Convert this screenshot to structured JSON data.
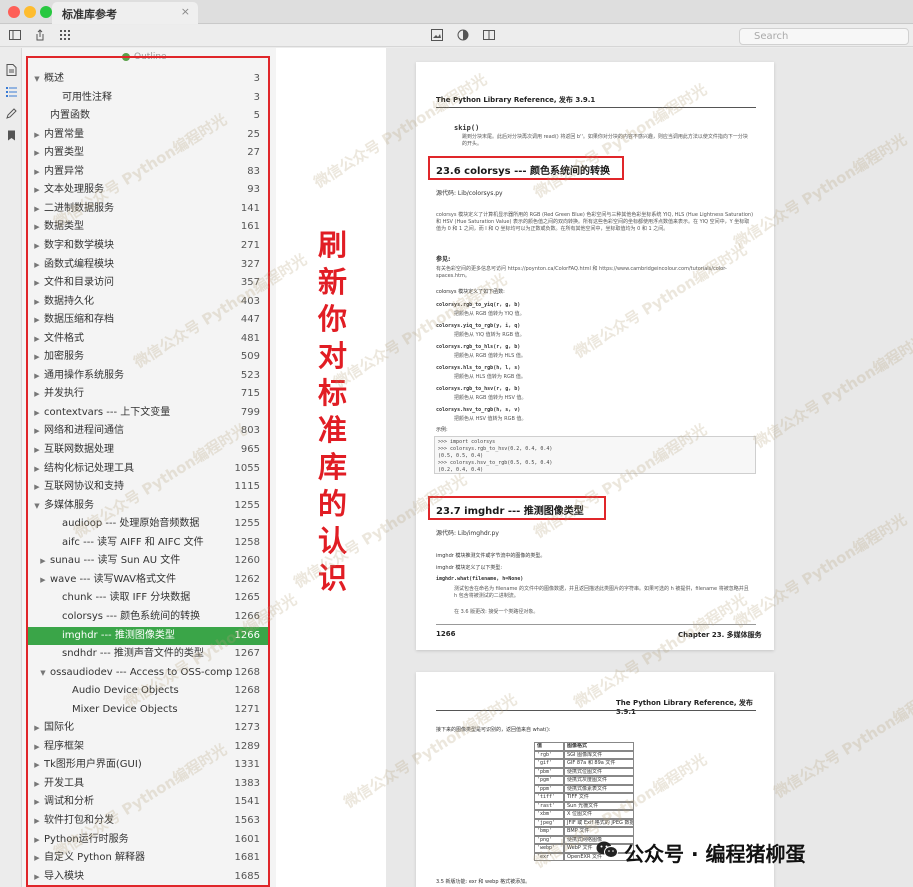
{
  "window": {
    "tab_title": "标准库参考",
    "tab_close": "×",
    "search_placeholder": "Search"
  },
  "sidebar": {
    "outline_label": "Outline",
    "items": [
      {
        "label": "概述",
        "page": "3",
        "level": 0,
        "arrow": "▼"
      },
      {
        "label": "可用性注释",
        "page": "3",
        "level": 2,
        "arrow": ""
      },
      {
        "label": "内置函数",
        "page": "5",
        "level": 1,
        "arrow": ""
      },
      {
        "label": "内置常量",
        "page": "25",
        "level": 0,
        "arrow": "▶"
      },
      {
        "label": "内置类型",
        "page": "27",
        "level": 0,
        "arrow": "▶"
      },
      {
        "label": "内置异常",
        "page": "83",
        "level": 0,
        "arrow": "▶"
      },
      {
        "label": "文本处理服务",
        "page": "93",
        "level": 0,
        "arrow": "▶"
      },
      {
        "label": "二进制数据服务",
        "page": "141",
        "level": 0,
        "arrow": "▶"
      },
      {
        "label": "数据类型",
        "page": "161",
        "level": 0,
        "arrow": "▶"
      },
      {
        "label": "数字和数学模块",
        "page": "271",
        "level": 0,
        "arrow": "▶"
      },
      {
        "label": "函数式编程模块",
        "page": "327",
        "level": 0,
        "arrow": "▶"
      },
      {
        "label": "文件和目录访问",
        "page": "357",
        "level": 0,
        "arrow": "▶"
      },
      {
        "label": "数据持久化",
        "page": "403",
        "level": 0,
        "arrow": "▶"
      },
      {
        "label": "数据压缩和存档",
        "page": "447",
        "level": 0,
        "arrow": "▶"
      },
      {
        "label": "文件格式",
        "page": "481",
        "level": 0,
        "arrow": "▶"
      },
      {
        "label": "加密服务",
        "page": "509",
        "level": 0,
        "arrow": "▶"
      },
      {
        "label": "通用操作系统服务",
        "page": "523",
        "level": 0,
        "arrow": "▶"
      },
      {
        "label": "并发执行",
        "page": "715",
        "level": 0,
        "arrow": "▶"
      },
      {
        "label": "contextvars --- 上下文变量",
        "page": "799",
        "level": 0,
        "arrow": "▶"
      },
      {
        "label": "网络和进程间通信",
        "page": "803",
        "level": 0,
        "arrow": "▶"
      },
      {
        "label": "互联网数据处理",
        "page": "965",
        "level": 0,
        "arrow": "▶"
      },
      {
        "label": "结构化标记处理工具",
        "page": "1055",
        "level": 0,
        "arrow": "▶"
      },
      {
        "label": "互联网协议和支持",
        "page": "1115",
        "level": 0,
        "arrow": "▶"
      },
      {
        "label": "多媒体服务",
        "page": "1255",
        "level": 0,
        "arrow": "▼"
      },
      {
        "label": "audioop --- 处理原始音频数据",
        "page": "1255",
        "level": 2,
        "arrow": ""
      },
      {
        "label": "aifc --- 读写 AIFF 和 AIFC 文件",
        "page": "1258",
        "level": 2,
        "arrow": ""
      },
      {
        "label": "sunau --- 读写 Sun AU 文件",
        "page": "1260",
        "level": 1,
        "arrow": "▶"
      },
      {
        "label": "wave --- 读写WAV格式文件",
        "page": "1262",
        "level": 1,
        "arrow": "▶"
      },
      {
        "label": "chunk --- 读取 IFF 分块数据",
        "page": "1265",
        "level": 2,
        "arrow": ""
      },
      {
        "label": "colorsys --- 颜色系统间的转换",
        "page": "1266",
        "level": 2,
        "arrow": ""
      },
      {
        "label": "imghdr --- 推测图像类型",
        "page": "1266",
        "level": 2,
        "arrow": "",
        "active": true
      },
      {
        "label": "sndhdr --- 推测声音文件的类型",
        "page": "1267",
        "level": 2,
        "arrow": ""
      },
      {
        "label": "ossaudiodev --- Access to OSS-compa...",
        "page": "1268",
        "level": 1,
        "arrow": "▼"
      },
      {
        "label": "Audio Device Objects",
        "page": "1268",
        "level": 3,
        "arrow": ""
      },
      {
        "label": "Mixer Device Objects",
        "page": "1271",
        "level": 3,
        "arrow": ""
      },
      {
        "label": "国际化",
        "page": "1273",
        "level": 0,
        "arrow": "▶"
      },
      {
        "label": "程序框架",
        "page": "1289",
        "level": 0,
        "arrow": "▶"
      },
      {
        "label": "Tk图形用户界面(GUI)",
        "page": "1331",
        "level": 0,
        "arrow": "▶"
      },
      {
        "label": "开发工具",
        "page": "1383",
        "level": 0,
        "arrow": "▶"
      },
      {
        "label": "调试和分析",
        "page": "1541",
        "level": 0,
        "arrow": "▶"
      },
      {
        "label": "软件打包和分发",
        "page": "1563",
        "level": 0,
        "arrow": "▶"
      },
      {
        "label": "Python运行时服务",
        "page": "1601",
        "level": 0,
        "arrow": "▶"
      },
      {
        "label": "自定义 Python 解释器",
        "page": "1681",
        "level": 0,
        "arrow": "▶"
      },
      {
        "label": "导入模块",
        "page": "1685",
        "level": 0,
        "arrow": "▶"
      }
    ]
  },
  "annotation": {
    "chars": [
      "刷",
      "新",
      "你",
      "对",
      "标",
      "准",
      "库",
      "的",
      "认",
      "识"
    ]
  },
  "page1": {
    "header": "The Python Library Reference, 发布 3.9.1",
    "skip_term": "skip()",
    "skip_desc": "跳到分块末尾。此后对分块再次调用 read() 将返回 b''。如果你对分块的内容不感兴趣，则应当调用此方法以使文件指向下一分块的开头。",
    "sec1_title": "23.6 colorsys --- 颜色系统间的转换",
    "sec1_source": "源代码: Lib/colorsys.py",
    "sec1_intro": "colorsys 模块定义了计算机显示器所用的 RGB (Red Green Blue) 色彩空间与三种其他色彩坐标系统 YIQ, HLS (Hue Lightness Saturation) 和 HSV (Hue Saturation Value) 表示的颜色值之间的双向转换。所有这些色彩空间的坐标都使用浮点数值来表示。在 YIQ 空间中，Y 坐标取值为 0 和 1 之间，而 I 和 Q 坐标均可以为正数或负数。在所有其他空间中，坐标取值均为 0 和 1 之间。",
    "see_also": "参见:",
    "see_also_text": "有关色彩空间的更多信息可访问 https://poynton.ca/ColorFAQ.html 和 https://www.cambridgeincolour.com/tutorials/color-spaces.htm。",
    "module_defines": "colorsys 模块定义了如下函数:",
    "functions": [
      {
        "sig": "colorsys.rgb_to_yiq(r, g, b)",
        "desc": "把颜色从 RGB 值转为 YIQ 值。"
      },
      {
        "sig": "colorsys.yiq_to_rgb(y, i, q)",
        "desc": "把颜色从 YIQ 值转为 RGB 值。"
      },
      {
        "sig": "colorsys.rgb_to_hls(r, g, b)",
        "desc": "把颜色从 RGB 值转为 HLS 值。"
      },
      {
        "sig": "colorsys.hls_to_rgb(h, l, s)",
        "desc": "把颜色从 HLS 值转为 RGB 值。"
      },
      {
        "sig": "colorsys.rgb_to_hsv(r, g, b)",
        "desc": "把颜色从 RGB 值转为 HSV 值。"
      },
      {
        "sig": "colorsys.hsv_to_rgb(h, s, v)",
        "desc": "把颜色从 HSV 值转为 RGB 值。"
      }
    ],
    "example_label": "示例:",
    "code_lines": [
      ">>> import colorsys",
      ">>> colorsys.rgb_to_hsv(0.2, 0.4, 0.4)",
      "(0.5, 0.5, 0.4)",
      ">>> colorsys.hsv_to_rgb(0.5, 0.5, 0.4)",
      "(0.2, 0.4, 0.4)"
    ],
    "sec2_title": "23.7 imghdr --- 推测图像类型",
    "sec2_source": "源代码: Lib/imghdr.py",
    "sec2_intro": "imghdr 模块推测文件或字节流中的图像的类型。",
    "sec2_defines": "imghdr 模块定义了以下类型:",
    "what_sig": "imghdr.what(filename, h=None)",
    "what_desc": "测试包含在命名为 filename 的文件中的图像数据，并且返回描述此类图片的字符串。如果可选的 h 被提供，filename 将被忽略并且 h 包含将被测试的二进制流。",
    "version_note": "在 3.6 版更改: 接受一个类路径对象。",
    "footer_left": "1266",
    "footer_right": "Chapter 23. 多媒体服务"
  },
  "page2": {
    "header": "The Python Library Reference, 发布 3.9.1",
    "intro": "接下来的图像类型是可识别的，返回值来自 what():",
    "table_headers": [
      "值",
      "图像格式"
    ],
    "table_rows": [
      [
        "'rgb'",
        "SGI 图像库文件"
      ],
      [
        "'gif'",
        "GIF 87a 和 89a 文件"
      ],
      [
        "'pbm'",
        "便携式位图文件"
      ],
      [
        "'pgm'",
        "便携式灰度图文件"
      ],
      [
        "'ppm'",
        "便携式像素表文件"
      ],
      [
        "'tiff'",
        "TIFF 文件"
      ],
      [
        "'rast'",
        "Sun 光栅文件"
      ],
      [
        "'xbm'",
        "X 位图文件"
      ],
      [
        "'jpeg'",
        "JFIF 或 Exif 格式的 JPEG 数据"
      ],
      [
        "'bmp'",
        "BMP 文件"
      ],
      [
        "'png'",
        "便携式网络图像"
      ],
      [
        "'webp'",
        "WebP 文件"
      ],
      [
        "'exr'",
        "OpenEXR 文件"
      ]
    ],
    "bottom_note": "3.5 新版功能: exr 和 webp 格式被添加。"
  },
  "watermark": {
    "text": "微信公众号 Python编程时光"
  },
  "badge": {
    "text": "公众号 · 编程猪柳蛋"
  },
  "colors": {
    "accent_green": "#3aa548",
    "annotation_red": "#e11d24",
    "close": "#fe5f57",
    "minimize": "#febc2e",
    "zoom": "#28c840"
  }
}
